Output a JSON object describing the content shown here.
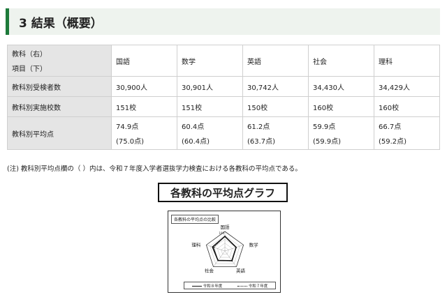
{
  "heading": "3 結果（概要）",
  "table": {
    "corner_line1": "教科（右）",
    "corner_line2": "項目（下）",
    "subjects": [
      "国語",
      "数学",
      "英語",
      "社会",
      "理科"
    ],
    "rows": [
      {
        "label": "教科別受検者数",
        "cells": [
          "30,900人",
          "30,901人",
          "30,742人",
          "34,430人",
          "34,429人"
        ]
      },
      {
        "label": "教科別実施校数",
        "cells": [
          "151校",
          "151校",
          "150校",
          "160校",
          "160校"
        ]
      },
      {
        "label": "教科別平均点",
        "cells": [
          "74.9点",
          "60.4点",
          "61.2点",
          "59.9点",
          "66.7点"
        ],
        "sub": [
          "(75.0点)",
          "(60.4点)",
          "(63.7点)",
          "(59.9点)",
          "(59.2点)"
        ]
      }
    ]
  },
  "note": "(注) 教科別平均点欄の（ ）内は、令和７年度入学者選抜学力検査における各教科の平均点である。",
  "graph_title": "各教科の平均点グラフ",
  "figure": {
    "caption": "各教科の平均点の比較",
    "legend_current": "令和８年度",
    "legend_previous": "令和７年度",
    "axis_max_label": "100"
  },
  "chart_data": {
    "type": "radar",
    "title": "各教科の平均点の比較",
    "axes": [
      "国語",
      "数学",
      "英語",
      "社会",
      "理科"
    ],
    "range": [
      0,
      100
    ],
    "series": [
      {
        "name": "令和８年度",
        "values": [
          74.9,
          60.4,
          61.2,
          59.9,
          66.7
        ]
      },
      {
        "name": "令和７年度",
        "values": [
          75.0,
          60.4,
          63.7,
          59.9,
          59.2
        ]
      }
    ]
  }
}
